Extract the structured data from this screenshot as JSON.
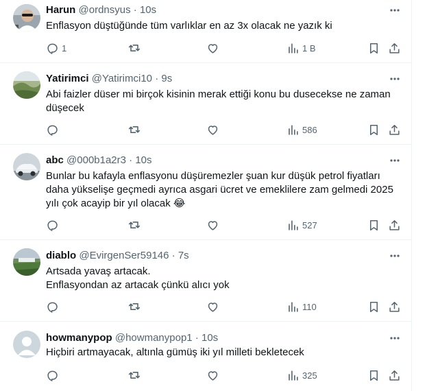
{
  "tweets": [
    {
      "name": "Harun",
      "handle": "@ordnsyus",
      "sep": "·",
      "time": "10s",
      "lines": [
        "Enflasyon düştüğünde tüm varlıklar en az 3x olacak ne yazık ki"
      ],
      "reply_count": "1",
      "retweet_count": "",
      "like_count": "",
      "view_count": "1 B",
      "avatar": "photo-man-with-sunglasses"
    },
    {
      "name": "Yatirimci",
      "handle": "@Yatirimci10",
      "sep": "·",
      "time": "9s",
      "lines": [
        "Abi faizler düser mi birçok kisinin merak ettiği konu bu dusecekse ne zaman",
        "düşecek"
      ],
      "reply_count": "",
      "retweet_count": "",
      "like_count": "",
      "view_count": "586",
      "avatar": "photo-landscape-green"
    },
    {
      "name": "abc",
      "handle": "@000b1a2r3",
      "sep": "·",
      "time": "10s",
      "lines": [
        "Bunlar bu kafayla enflasyonu düşüremezler şuan kur düşük petrol fiyatları",
        "daha yükselişe geçmedi ayrıca asgari ücret ve emeklilere zam gelmedi 2025",
        "yılı çok acayip bir yıl olacak 😂"
      ],
      "reply_count": "",
      "retweet_count": "",
      "like_count": "",
      "view_count": "527",
      "avatar": "photo-white-car"
    },
    {
      "name": "diablo",
      "handle": "@EvirgenSer59146",
      "sep": "·",
      "time": "7s",
      "lines": [
        "Artsada yavaş artacak.",
        "Enflasyondan az artacak çünkü alıcı yok"
      ],
      "reply_count": "",
      "retweet_count": "",
      "like_count": "",
      "view_count": "110",
      "avatar": "photo-field-landscape"
    },
    {
      "name": "howmanypop",
      "handle": "@howmanypop1",
      "sep": "·",
      "time": "10s",
      "lines": [
        "Hiçbiri artmayacak, altınla gümüş iki yıl milleti bekletecek"
      ],
      "reply_count": "",
      "retweet_count": "",
      "like_count": "",
      "view_count": "325",
      "avatar": "default-avatar-placeholder"
    }
  ],
  "icons": {
    "more": "more-dots-icon",
    "reply": "reply-icon",
    "retweet": "retweet-icon",
    "like": "like-icon",
    "views": "views-icon",
    "bookmark": "bookmark-icon",
    "share": "share-icon"
  },
  "colors": {
    "text": "#0f1419",
    "muted": "#536471",
    "border": "#eff3f4",
    "avatar_placeholder": "#ccd6dd"
  }
}
